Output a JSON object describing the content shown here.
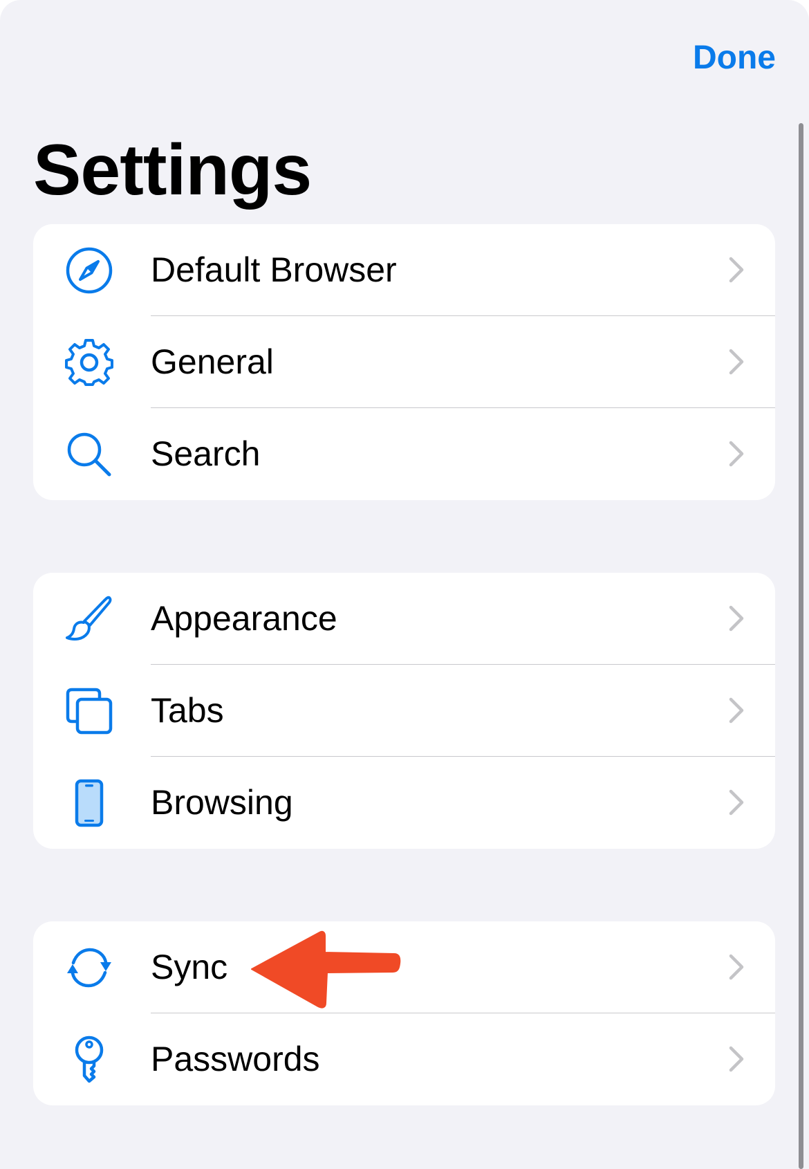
{
  "header": {
    "done_label": "Done",
    "title": "Settings"
  },
  "groups": [
    {
      "items": [
        {
          "label": "Default Browser",
          "icon": "compass-icon"
        },
        {
          "label": "General",
          "icon": "gear-icon"
        },
        {
          "label": "Search",
          "icon": "search-icon"
        }
      ]
    },
    {
      "items": [
        {
          "label": "Appearance",
          "icon": "paintbrush-icon"
        },
        {
          "label": "Tabs",
          "icon": "tabs-icon"
        },
        {
          "label": "Browsing",
          "icon": "phone-icon"
        }
      ]
    },
    {
      "items": [
        {
          "label": "Sync",
          "icon": "sync-icon"
        },
        {
          "label": "Passwords",
          "icon": "key-icon"
        }
      ]
    }
  ],
  "colors": {
    "accent": "#0a7bea",
    "background": "#f2f2f7",
    "annotation_arrow": "#f04a26"
  }
}
